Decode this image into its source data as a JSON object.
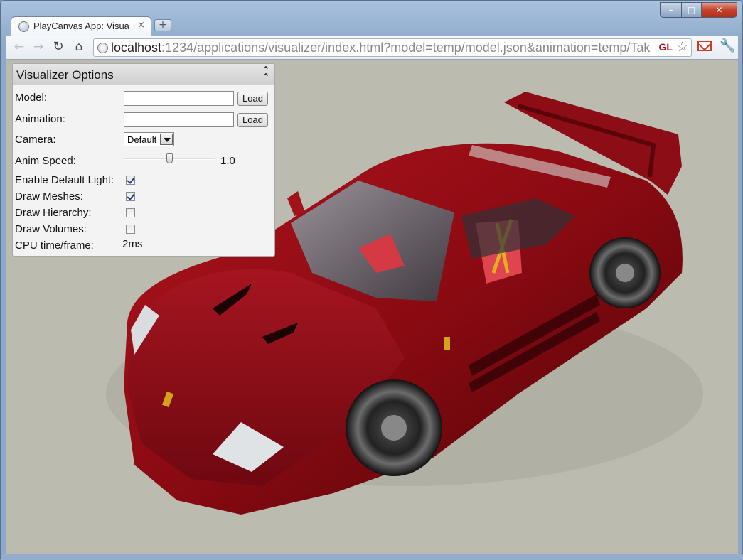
{
  "window": {
    "controls": {
      "minimize": "–",
      "maximize": "□",
      "close": "✕"
    }
  },
  "tab": {
    "title": "PlayCanvas App: Visua",
    "close": "×",
    "new_tab": "+"
  },
  "toolbar": {
    "back": "←",
    "forward": "→",
    "reload": "↻",
    "home": "⌂",
    "url_host": "localhost",
    "url_rest": ":1234/applications/visualizer/index.html?model=temp/model.json&animation=temp/Tak",
    "gl_badge": "GL",
    "star": "☆",
    "wrench": "🔧"
  },
  "panel": {
    "title": "Visualizer Options",
    "collapse": "⌃⌃",
    "model_label": "Model:",
    "model_value": "",
    "model_load": "Load",
    "animation_label": "Animation:",
    "animation_value": "",
    "animation_load": "Load",
    "camera_label": "Camera:",
    "camera_value": "Default",
    "anim_speed_label": "Anim Speed:",
    "anim_speed_value": "1.0",
    "anim_speed_fraction": 0.5,
    "enable_light_label": "Enable Default Light:",
    "enable_light_checked": true,
    "draw_meshes_label": "Draw Meshes:",
    "draw_meshes_checked": true,
    "draw_hierarchy_label": "Draw Hierarchy:",
    "draw_hierarchy_checked": false,
    "draw_volumes_label": "Draw Volumes:",
    "draw_volumes_checked": false,
    "cpu_label": "CPU time/frame:",
    "cpu_value": "2ms"
  },
  "scene": {
    "subject": "red sports car model",
    "background": "#bcbbb0"
  }
}
